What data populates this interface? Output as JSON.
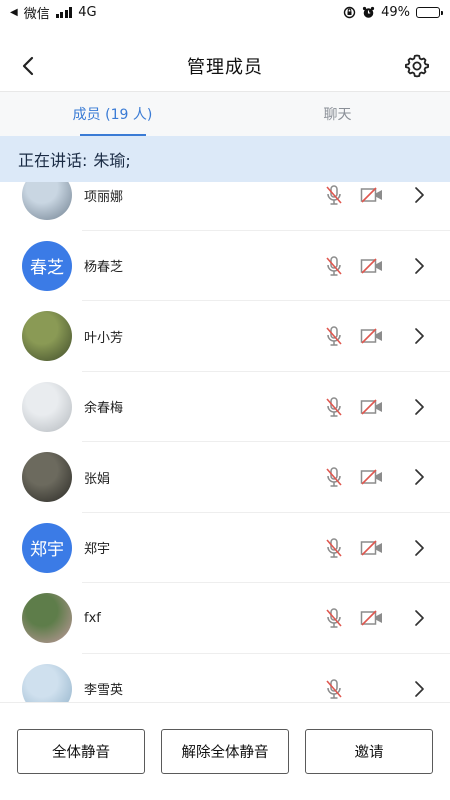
{
  "status_bar": {
    "back_app": "微信",
    "network": "4G",
    "battery": "49%",
    "battery_level": 0.49,
    "icons": [
      "back-arrow-icon",
      "signal-icon",
      "orientation-lock-icon",
      "alarm-icon",
      "battery-icon"
    ]
  },
  "nav": {
    "title": "管理成员",
    "back_icon": "chevron-left-icon",
    "settings_icon": "gear-icon"
  },
  "tabs": [
    {
      "label": "成员 (19 人)",
      "active": true
    },
    {
      "label": "聊天",
      "active": false
    }
  ],
  "speaking": {
    "prefix": "正在讲话:",
    "names": "朱瑜;"
  },
  "members": [
    {
      "name": "项丽娜",
      "avatar_type": "photo",
      "avatar_colors": [
        "#c9d6e2",
        "#6f7f8f"
      ],
      "mic_muted": true,
      "cam_off": true
    },
    {
      "name": "杨春芝",
      "avatar_type": "text",
      "avatar_text": "春芝",
      "mic_muted": true,
      "cam_off": true
    },
    {
      "name": "叶小芳",
      "avatar_type": "photo",
      "avatar_colors": [
        "#8a9a55",
        "#3e4a2a"
      ],
      "mic_muted": true,
      "cam_off": true
    },
    {
      "name": "余春梅",
      "avatar_type": "photo",
      "avatar_colors": [
        "#e9ecef",
        "#b3b8bd"
      ],
      "mic_muted": true,
      "cam_off": true
    },
    {
      "name": "张娟",
      "avatar_type": "photo",
      "avatar_colors": [
        "#6c6a5e",
        "#2a2925"
      ],
      "mic_muted": true,
      "cam_off": true
    },
    {
      "name": "郑宇",
      "avatar_type": "text",
      "avatar_text": "郑宇",
      "mic_muted": true,
      "cam_off": true
    },
    {
      "name": "fxf",
      "avatar_type": "photo",
      "avatar_colors": [
        "#5e7d4a",
        "#c49aa0"
      ],
      "mic_muted": true,
      "cam_off": true
    },
    {
      "name": "李雪英",
      "avatar_type": "photo",
      "avatar_colors": [
        "#cfe0ee",
        "#8fb0c8"
      ],
      "mic_muted": true,
      "cam_off": false
    }
  ],
  "actions": {
    "mute_all": "全体静音",
    "unmute_all": "解除全体静音",
    "invite": "邀请"
  },
  "colors": {
    "accent": "#3a7bd5",
    "banner_bg": "#dce9f8",
    "muted_red": "#e0574f",
    "icon_gray": "#8c8c8c"
  }
}
